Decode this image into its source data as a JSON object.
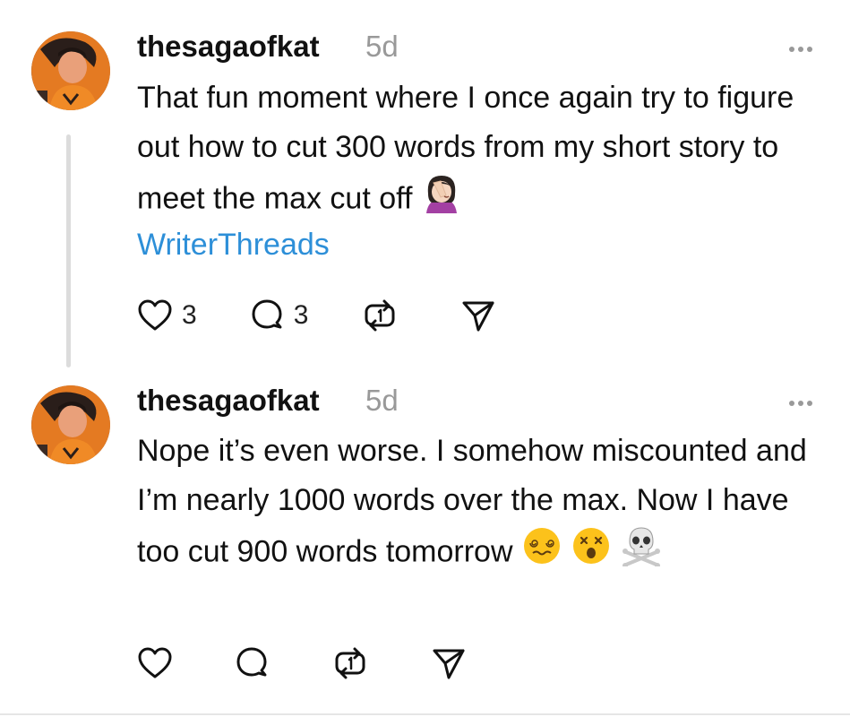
{
  "posts": [
    {
      "username": "thesagaofkat",
      "time": "5d",
      "text": "That fun moment where I once again try to figure out how to cut 300 words from my short story to meet the max cut off",
      "emojis": [
        "facepalm-emoji"
      ],
      "tag": "WriterThreads",
      "likes": "3",
      "replies": "3",
      "icons": [
        "heart-icon",
        "comment-icon",
        "repost-icon",
        "share-icon"
      ]
    },
    {
      "username": "thesagaofkat",
      "time": "5d",
      "text": "Nope it’s even worse. I somehow miscounted and I’m nearly 1000 words over the max. Now I have too cut 900 words tomorrow",
      "emojis": [
        "dizzy-face-emoji",
        "astonished-face-emoji",
        "skull-crossbones-emoji"
      ],
      "icons": [
        "heart-icon",
        "comment-icon",
        "repost-icon",
        "share-icon"
      ]
    }
  ]
}
